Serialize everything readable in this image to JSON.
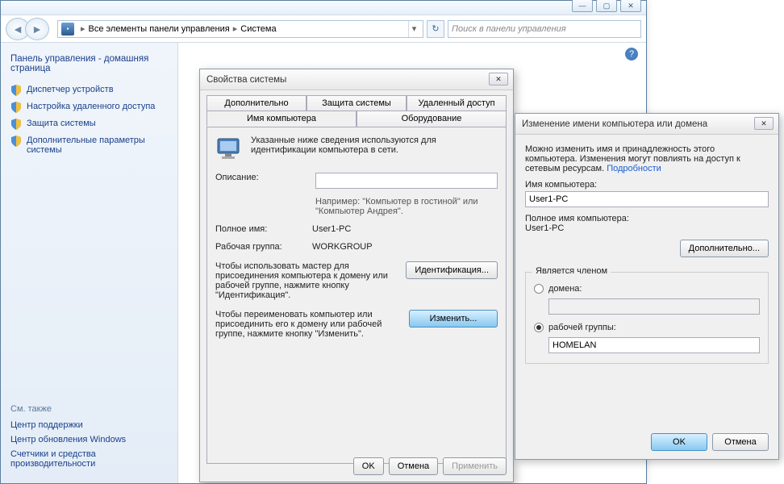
{
  "window": {
    "breadcrumb": {
      "item1": "Все элементы панели управления",
      "item2": "Система"
    },
    "search_placeholder": "Поиск в панели управления"
  },
  "sidebar": {
    "head": "Панель управления - домашняя страница",
    "tasks": [
      "Диспетчер устройств",
      "Настройка удаленного доступа",
      "Защита системы",
      "Дополнительные параметры системы"
    ],
    "see_also": "См. также",
    "bottom": [
      "Центр поддержки",
      "Центр обновления Windows",
      "Счетчики и средства производительности"
    ]
  },
  "sysprops": {
    "title": "Свойства системы",
    "tabs": {
      "advanced": "Дополнительно",
      "protection": "Защита системы",
      "remote": "Удаленный доступ",
      "name": "Имя компьютера",
      "hardware": "Оборудование"
    },
    "info": "Указанные ниже сведения используются для идентификации компьютера в сети.",
    "desc_label": "Описание:",
    "desc_hint": "Например: \"Компьютер в гостиной\" или \"Компьютер Андрея\".",
    "fullname_label": "Полное имя:",
    "fullname_val": "User1-PC",
    "workgroup_label": "Рабочая группа:",
    "workgroup_val": "WORKGROUP",
    "wizard_text": "Чтобы использовать мастер для присоединения компьютера к домену или рабочей группе, нажмите кнопку \"Идентификация\".",
    "wizard_btn": "Идентификация...",
    "change_text": "Чтобы переименовать компьютер или присоединить его к домену или рабочей группе, нажмите кнопку \"Изменить\".",
    "change_btn": "Изменить...",
    "ok": "OK",
    "cancel": "Отмена",
    "apply": "Применить"
  },
  "rename": {
    "title": "Изменение имени компьютера или домена",
    "intro": "Можно изменить имя и принадлежность этого компьютера. Изменения могут повлиять на доступ к сетевым ресурсам.",
    "details_link": "Подробности",
    "name_label": "Имя компьютера:",
    "name_val": "User1-PC",
    "fullname_label": "Полное имя компьютера:",
    "fullname_val": "User1-PC",
    "more_btn": "Дополнительно...",
    "member_group": "Является членом",
    "radio_domain": "домена:",
    "radio_workgroup": "рабочей группы:",
    "workgroup_val": "HOMELAN",
    "ok": "OK",
    "cancel": "Отмена"
  }
}
